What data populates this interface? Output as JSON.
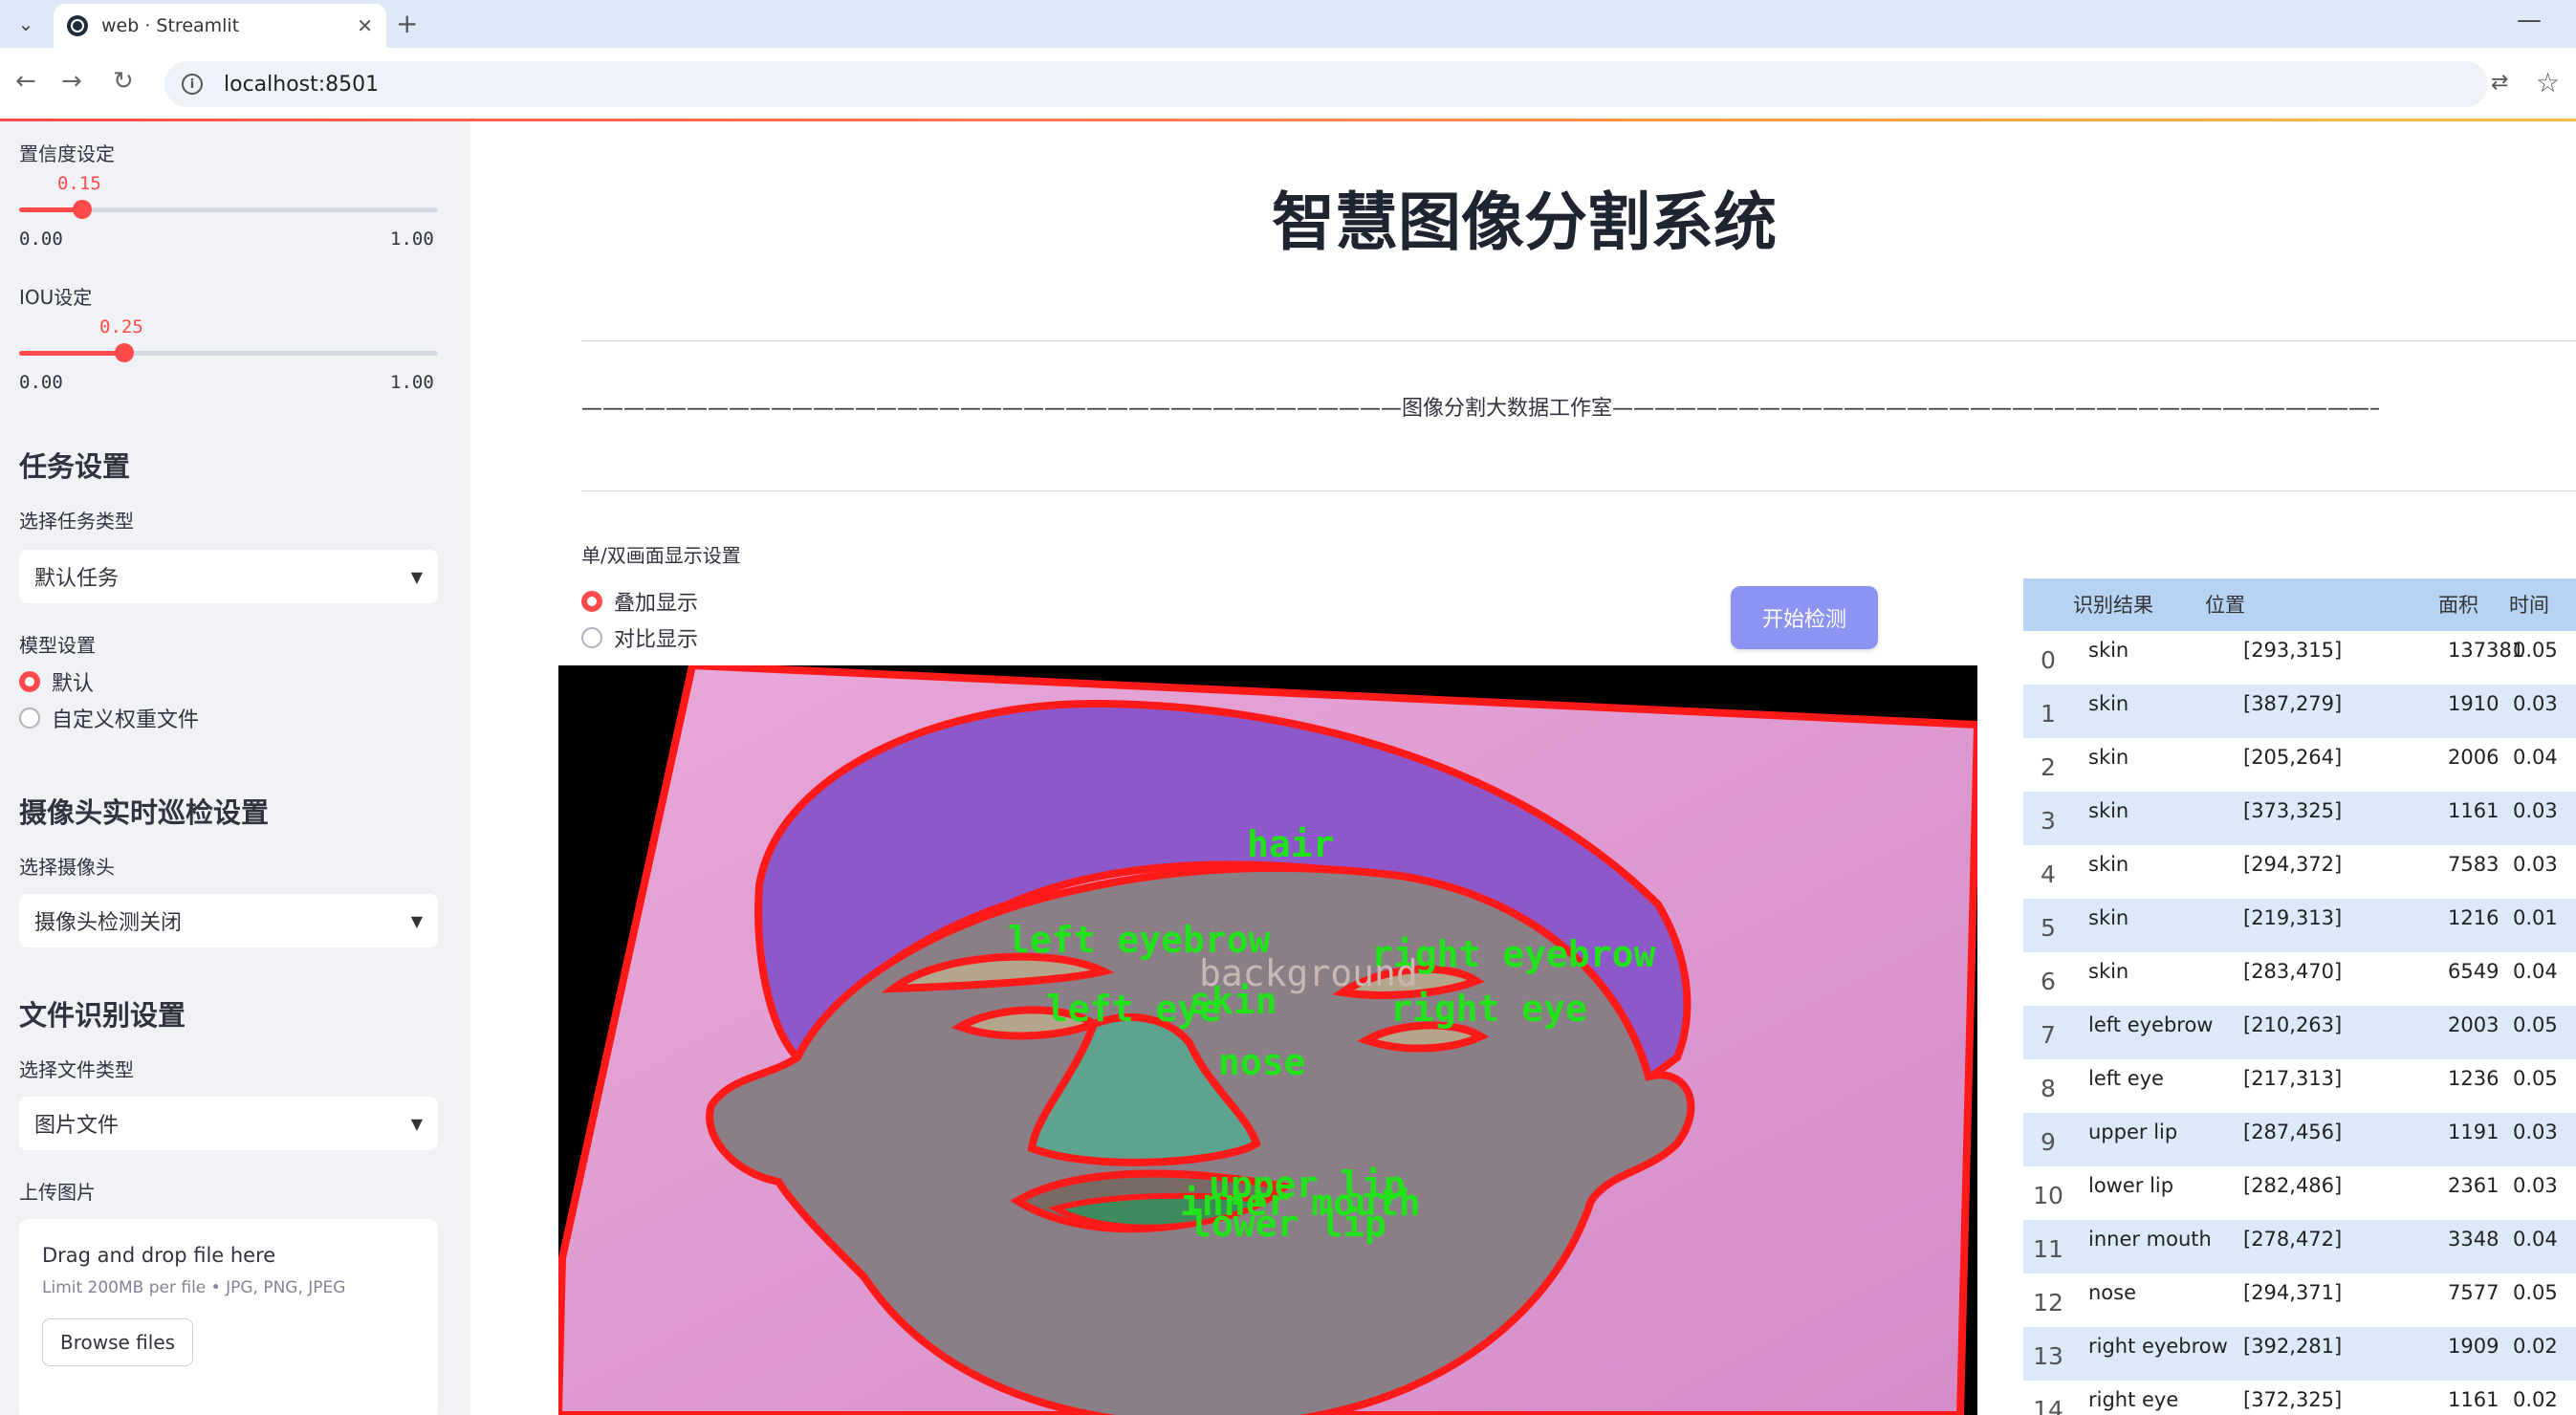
{
  "browser": {
    "tab_title": "web · Streamlit",
    "url": "localhost:8501"
  },
  "sidebar": {
    "confidence": {
      "label": "置信度设定",
      "value": "0.15",
      "value_num": 0.15,
      "min": "0.00",
      "max": "1.00"
    },
    "iou": {
      "label": "IOU设定",
      "value": "0.25",
      "value_num": 0.25,
      "min": "0.00",
      "max": "1.00"
    },
    "task_section": "任务设置",
    "task_type_label": "选择任务类型",
    "task_type_value": "默认任务",
    "model_label": "模型设置",
    "model_options": [
      "默认",
      "自定义权重文件"
    ],
    "camera_section": "摄像头实时巡检设置",
    "camera_label": "选择摄像头",
    "camera_value": "摄像头检测关闭",
    "file_section": "文件识别设置",
    "file_type_label": "选择文件类型",
    "file_type_value": "图片文件",
    "upload_label": "上传图片",
    "upload_title": "Drag and drop file here",
    "upload_limit": "Limit 200MB per file • JPG, PNG, JPEG",
    "browse_button": "Browse files"
  },
  "main": {
    "title": "智慧图像分割系统",
    "divider_text": "———————————————————————————————————————图像分割大数据工作室———————————————————————————————————————",
    "display_label": "单/双画面显示设置",
    "display_options": [
      "叠加显示",
      "对比显示"
    ],
    "start_button": "开始检测",
    "image_labels": {
      "hair": "hair",
      "left_eyebrow": "left eyebrow",
      "right_eyebrow": "right eyebrow",
      "background": "background",
      "left_eye": "left eye",
      "skin": "skin",
      "right_eye": "right eye",
      "nose": "nose",
      "upper_lip": "upper lip",
      "inner_mouth": "inner mouth",
      "lower_lip": "lower lip"
    }
  },
  "results_table": {
    "headers": [
      "识别结果",
      "位置",
      "面积",
      "时间"
    ],
    "rows": [
      {
        "i": "0",
        "name": "skin",
        "pos": "[293,315]",
        "area": "137381",
        "time": "0.05"
      },
      {
        "i": "1",
        "name": "skin",
        "pos": "[387,279]",
        "area": "1910",
        "time": "0.03"
      },
      {
        "i": "2",
        "name": "skin",
        "pos": "[205,264]",
        "area": "2006",
        "time": "0.04"
      },
      {
        "i": "3",
        "name": "skin",
        "pos": "[373,325]",
        "area": "1161",
        "time": "0.03"
      },
      {
        "i": "4",
        "name": "skin",
        "pos": "[294,372]",
        "area": "7583",
        "time": "0.03"
      },
      {
        "i": "5",
        "name": "skin",
        "pos": "[219,313]",
        "area": "1216",
        "time": "0.01"
      },
      {
        "i": "6",
        "name": "skin",
        "pos": "[283,470]",
        "area": "6549",
        "time": "0.04"
      },
      {
        "i": "7",
        "name": "left eyebrow",
        "pos": "[210,263]",
        "area": "2003",
        "time": "0.05"
      },
      {
        "i": "8",
        "name": "left eye",
        "pos": "[217,313]",
        "area": "1236",
        "time": "0.05"
      },
      {
        "i": "9",
        "name": "upper lip",
        "pos": "[287,456]",
        "area": "1191",
        "time": "0.03"
      },
      {
        "i": "10",
        "name": "lower lip",
        "pos": "[282,486]",
        "area": "2361",
        "time": "0.03"
      },
      {
        "i": "11",
        "name": "inner mouth",
        "pos": "[278,472]",
        "area": "3348",
        "time": "0.04"
      },
      {
        "i": "12",
        "name": "nose",
        "pos": "[294,371]",
        "area": "7577",
        "time": "0.05"
      },
      {
        "i": "13",
        "name": "right eyebrow",
        "pos": "[392,281]",
        "area": "1909",
        "time": "0.02"
      },
      {
        "i": "14",
        "name": "right eye",
        "pos": "[372,325]",
        "area": "1161",
        "time": "0.02"
      }
    ]
  },
  "colors": {
    "accent": "#ff4b4b",
    "button": "#8d93f3",
    "table_header": "#b7d3f3",
    "row_alt": "#dce9f8"
  }
}
